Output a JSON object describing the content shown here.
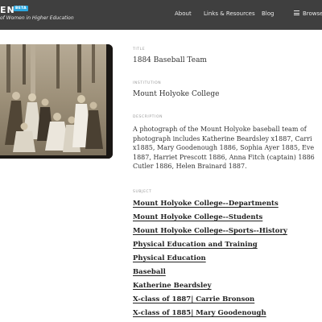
{
  "header": {
    "brand_name": "EN",
    "beta": "BETA",
    "subtitle": "of Women in Higher Education",
    "nav": {
      "about": "About",
      "links": "Links & Resources",
      "blog": "Blog",
      "browse": "Browse"
    }
  },
  "record": {
    "title_label": "TITLE",
    "title": "1884 Baseball Team",
    "institution_label": "INSTITUTION",
    "institution": "Mount Holyoke College",
    "description_label": "DESCRIPTION",
    "description_lines": [
      "A photograph of the Mount Holyoke baseball team of",
      "photograph includes Katherine Beardsley x1887, Carri",
      "x1885, Mary Goodenough 1886, Sophia Ayer 1885, Eve",
      "1887, Harriet Prescott 1886, Anna Fitch (captain) 1886",
      "Cutler 1886, Helen Brainard 1887."
    ],
    "subject_label": "SUBJECT",
    "subjects": [
      "Mount Holyoke College--Departments",
      "Mount Holyoke College--Students",
      "Mount Holyoke College--Sports--History",
      "Physical Education and Training",
      "Physical Education",
      "Baseball",
      "Katherine Beardsley",
      "X-class of 1887| Carrie Bronson",
      "X-class of 1885| Mary Goodenough"
    ]
  }
}
